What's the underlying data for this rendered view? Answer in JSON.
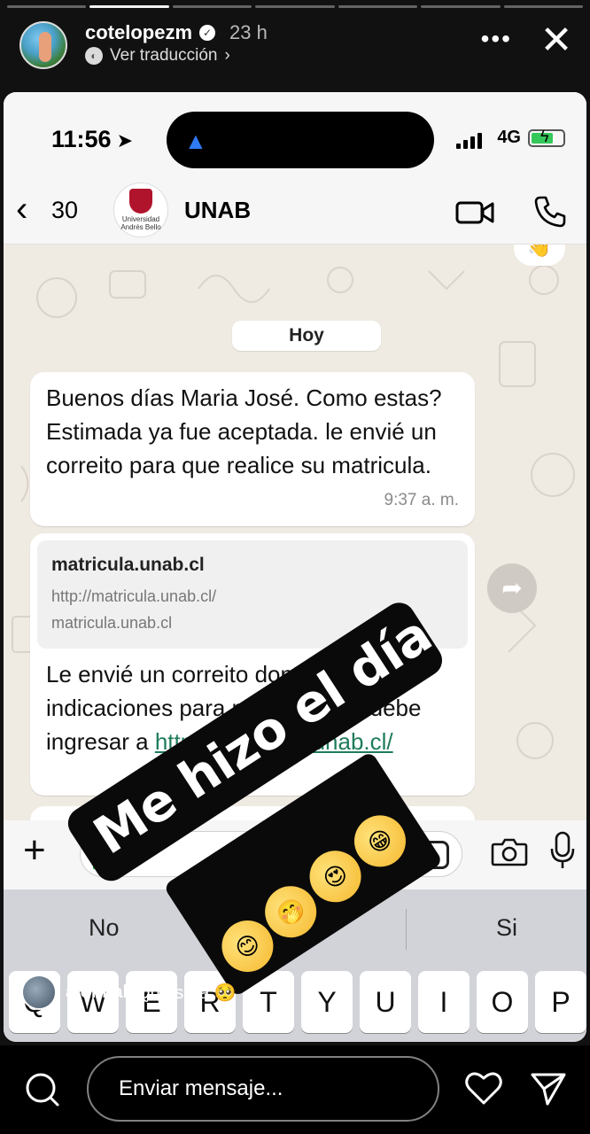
{
  "story": {
    "username": "cotelopezm",
    "time_ago": "23 h",
    "translate_label": "Ver traducción",
    "more_label": "•••",
    "close_label": "✕",
    "sticker_text": "Me hizo el día",
    "emojis": [
      "😊",
      "🤭",
      "😍",
      "😁"
    ],
    "reply": {
      "user": "alonbal",
      "text": "Qué será 🥺"
    },
    "message_placeholder": "Enviar mensaje..."
  },
  "phone": {
    "status": {
      "time": "11:56",
      "network": "4G"
    },
    "chat": {
      "back_count": "30",
      "contact_name": "UNAB",
      "logo_text": "Universidad Andrés Bello",
      "date_label": "Hoy",
      "message1": "Buenos días Maria José.  Como estas?  Estimada ya fue aceptada. le envié un correito para que realice su matricula.",
      "message1_time": "9:37 a. m.",
      "link_preview": {
        "title": "matricula.unab.cl",
        "url": "http://matricula.unab.cl/",
        "domain": "matricula.unab.cl"
      },
      "message2_text": "Le envié un correito donde están las indicaciones para matricularse, debe ingresar a ",
      "message2_link": "http://matricula.unab.cl/"
    },
    "keyboard": {
      "suggestions": [
        "No",
        "Si"
      ],
      "row": [
        "Q",
        "W",
        "E",
        "R",
        "T",
        "Y",
        "U",
        "I",
        "O",
        "P"
      ]
    }
  },
  "colors": {
    "whatsapp_bg": "#efeae2",
    "bubble": "#ffffff",
    "link": "#1f7c5a",
    "brand_red": "#b0142d"
  }
}
